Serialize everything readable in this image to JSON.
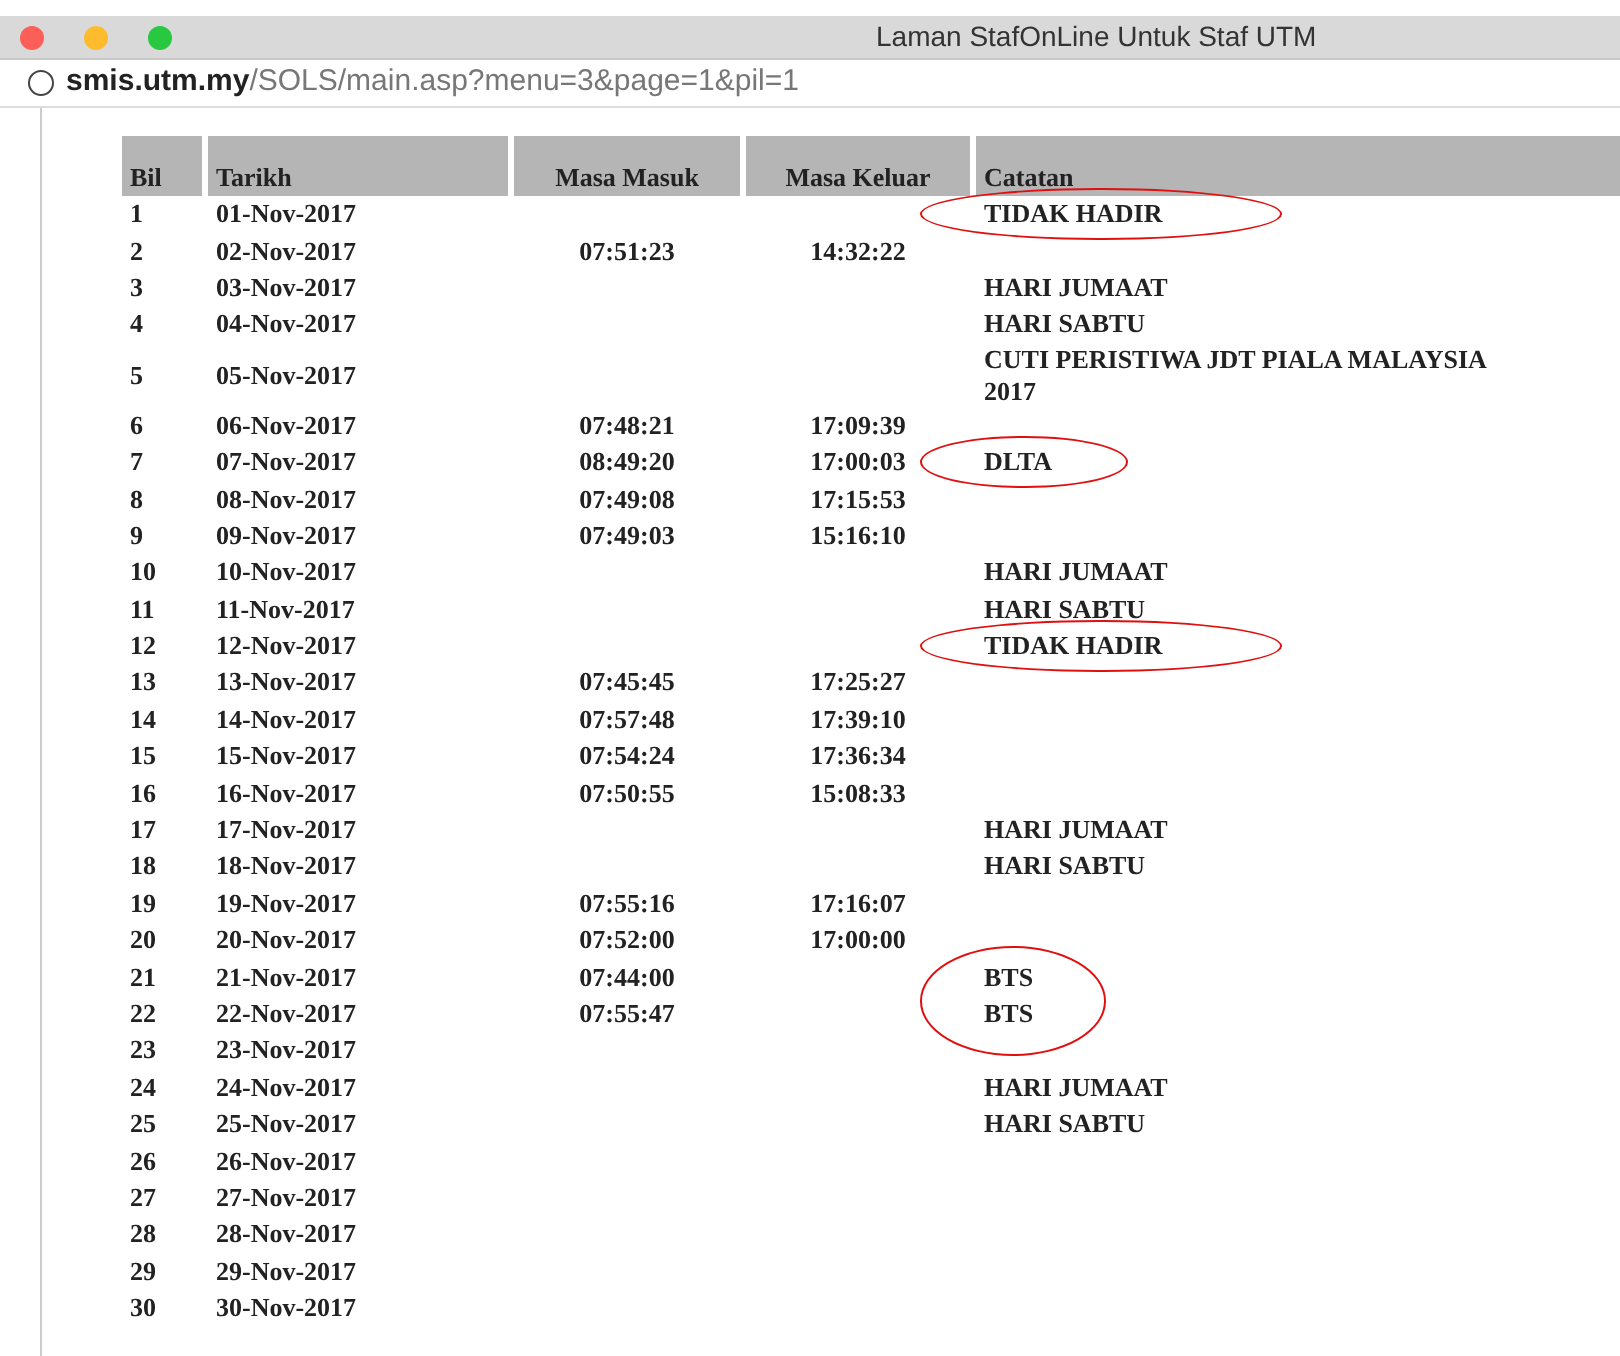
{
  "window": {
    "title": "Laman StafOnLine Untuk Staf UTM"
  },
  "address_bar": {
    "domain": "smis.utm.my",
    "path": "/SOLS/main.asp?menu=3&page=1&pil=1"
  },
  "table": {
    "columns": [
      "Bil",
      "Tarikh",
      "Masa Masuk",
      "Masa Keluar",
      "Catatan"
    ],
    "rows": [
      {
        "bil": "1",
        "tarikh": "01-Nov-2017",
        "masuk": "",
        "keluar": "",
        "catatan": "TIDAK HADIR",
        "circled": true
      },
      {
        "bil": "2",
        "tarikh": "02-Nov-2017",
        "masuk": "07:51:23",
        "keluar": "14:32:22",
        "catatan": "",
        "circled": false
      },
      {
        "bil": "3",
        "tarikh": "03-Nov-2017",
        "masuk": "",
        "keluar": "",
        "catatan": "HARI JUMAAT",
        "circled": false
      },
      {
        "bil": "4",
        "tarikh": "04-Nov-2017",
        "masuk": "",
        "keluar": "",
        "catatan": "HARI SABTU",
        "circled": false
      },
      {
        "bil": "5",
        "tarikh": "05-Nov-2017",
        "masuk": "",
        "keluar": "",
        "catatan": "CUTI PERISTIWA JDT PIALA MALAYSIA 2017",
        "circled": false
      },
      {
        "bil": "6",
        "tarikh": "06-Nov-2017",
        "masuk": "07:48:21",
        "keluar": "17:09:39",
        "catatan": "",
        "circled": false
      },
      {
        "bil": "7",
        "tarikh": "07-Nov-2017",
        "masuk": "08:49:20",
        "keluar": "17:00:03",
        "catatan": "DLTA",
        "circled": true
      },
      {
        "bil": "8",
        "tarikh": "08-Nov-2017",
        "masuk": "07:49:08",
        "keluar": "17:15:53",
        "catatan": "",
        "circled": false
      },
      {
        "bil": "9",
        "tarikh": "09-Nov-2017",
        "masuk": "07:49:03",
        "keluar": "15:16:10",
        "catatan": "",
        "circled": false
      },
      {
        "bil": "10",
        "tarikh": "10-Nov-2017",
        "masuk": "",
        "keluar": "",
        "catatan": "HARI JUMAAT",
        "circled": false
      },
      {
        "bil": "11",
        "tarikh": "11-Nov-2017",
        "masuk": "",
        "keluar": "",
        "catatan": "HARI SABTU",
        "circled": false
      },
      {
        "bil": "12",
        "tarikh": "12-Nov-2017",
        "masuk": "",
        "keluar": "",
        "catatan": "TIDAK HADIR",
        "circled": true
      },
      {
        "bil": "13",
        "tarikh": "13-Nov-2017",
        "masuk": "07:45:45",
        "keluar": "17:25:27",
        "catatan": "",
        "circled": false
      },
      {
        "bil": "14",
        "tarikh": "14-Nov-2017",
        "masuk": "07:57:48",
        "keluar": "17:39:10",
        "catatan": "",
        "circled": false
      },
      {
        "bil": "15",
        "tarikh": "15-Nov-2017",
        "masuk": "07:54:24",
        "keluar": "17:36:34",
        "catatan": "",
        "circled": false
      },
      {
        "bil": "16",
        "tarikh": "16-Nov-2017",
        "masuk": "07:50:55",
        "keluar": "15:08:33",
        "catatan": "",
        "circled": false
      },
      {
        "bil": "17",
        "tarikh": "17-Nov-2017",
        "masuk": "",
        "keluar": "",
        "catatan": "HARI JUMAAT",
        "circled": false
      },
      {
        "bil": "18",
        "tarikh": "18-Nov-2017",
        "masuk": "",
        "keluar": "",
        "catatan": "HARI SABTU",
        "circled": false
      },
      {
        "bil": "19",
        "tarikh": "19-Nov-2017",
        "masuk": "07:55:16",
        "keluar": "17:16:07",
        "catatan": "",
        "circled": false
      },
      {
        "bil": "20",
        "tarikh": "20-Nov-2017",
        "masuk": "07:52:00",
        "keluar": "17:00:00",
        "catatan": "",
        "circled": false
      },
      {
        "bil": "21",
        "tarikh": "21-Nov-2017",
        "masuk": "07:44:00",
        "keluar": "",
        "catatan": "BTS",
        "circled": true
      },
      {
        "bil": "22",
        "tarikh": "22-Nov-2017",
        "masuk": "07:55:47",
        "keluar": "",
        "catatan": "BTS",
        "circled": true
      },
      {
        "bil": "23",
        "tarikh": "23-Nov-2017",
        "masuk": "",
        "keluar": "",
        "catatan": "",
        "circled": false
      },
      {
        "bil": "24",
        "tarikh": "24-Nov-2017",
        "masuk": "",
        "keluar": "",
        "catatan": "HARI JUMAAT",
        "circled": false
      },
      {
        "bil": "25",
        "tarikh": "25-Nov-2017",
        "masuk": "",
        "keluar": "",
        "catatan": "HARI SABTU",
        "circled": false
      },
      {
        "bil": "26",
        "tarikh": "26-Nov-2017",
        "masuk": "",
        "keluar": "",
        "catatan": "",
        "circled": false
      },
      {
        "bil": "27",
        "tarikh": "27-Nov-2017",
        "masuk": "",
        "keluar": "",
        "catatan": "",
        "circled": false
      },
      {
        "bil": "28",
        "tarikh": "28-Nov-2017",
        "masuk": "",
        "keluar": "",
        "catatan": "",
        "circled": false
      },
      {
        "bil": "29",
        "tarikh": "29-Nov-2017",
        "masuk": "",
        "keluar": "",
        "catatan": "",
        "circled": false
      },
      {
        "bil": "30",
        "tarikh": "30-Nov-2017",
        "masuk": "",
        "keluar": "",
        "catatan": "",
        "circled": false
      }
    ]
  }
}
